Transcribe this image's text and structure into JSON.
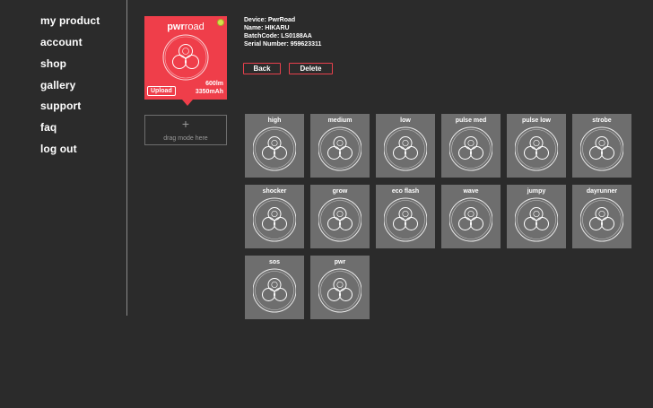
{
  "sidebar": {
    "items": [
      {
        "label": "my product"
      },
      {
        "label": "account"
      },
      {
        "label": "shop"
      },
      {
        "label": "gallery"
      },
      {
        "label": "support"
      },
      {
        "label": "faq"
      },
      {
        "label": "log out"
      }
    ]
  },
  "product_card": {
    "brand_bold": "pwr",
    "brand_light": "road",
    "upload_label": "Upload",
    "lumens": "600lm",
    "capacity": "3350mAh",
    "color": "#ef3e4a",
    "status_color": "#d6e04a",
    "icon": "light-head-icon"
  },
  "drag_slot": {
    "plus": "+",
    "label": "drag mode here"
  },
  "device_info": {
    "device": "Device: PwrRoad",
    "name": "Name: HIKARU",
    "batch": "BatchCode: LS0188AA",
    "serial": "Serial Number: 959623311"
  },
  "actions": {
    "back_label": "Back",
    "delete_label": "Delete"
  },
  "modes": [
    {
      "label": "high"
    },
    {
      "label": "medium"
    },
    {
      "label": "low"
    },
    {
      "label": "pulse med"
    },
    {
      "label": "pulse low"
    },
    {
      "label": "strobe"
    },
    {
      "label": "shocker"
    },
    {
      "label": "grow"
    },
    {
      "label": "eco flash"
    },
    {
      "label": "wave"
    },
    {
      "label": "jumpy"
    },
    {
      "label": "dayrunner"
    },
    {
      "label": "sos"
    },
    {
      "label": "pwr"
    }
  ]
}
